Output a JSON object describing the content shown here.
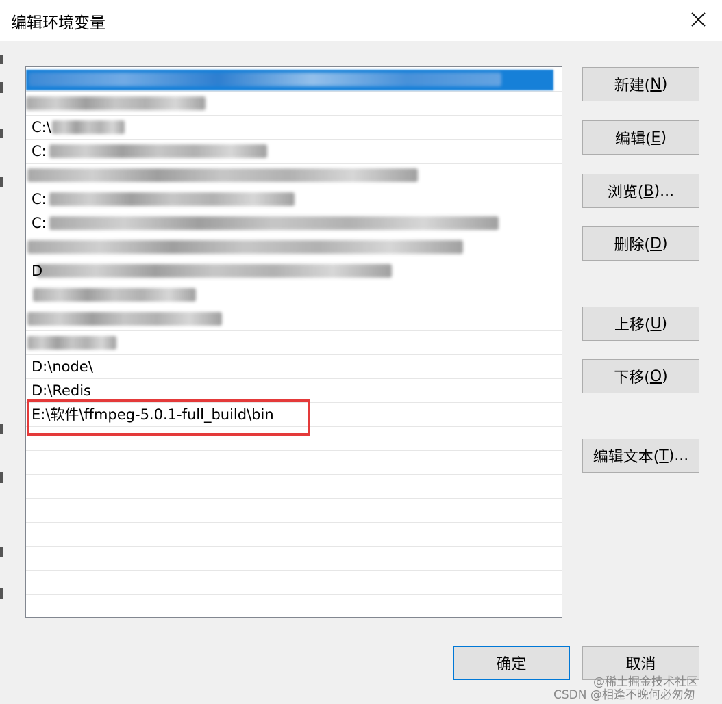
{
  "window": {
    "title": "编辑环境变量",
    "close_icon": "close-icon"
  },
  "list": {
    "items": [
      {
        "prefix": "",
        "selected": true
      },
      {
        "prefix": ""
      },
      {
        "prefix": "C:\\"
      },
      {
        "prefix": "C:"
      },
      {
        "prefix": ""
      },
      {
        "prefix": "C:"
      },
      {
        "prefix": "C:"
      },
      {
        "prefix": ""
      },
      {
        "prefix": "D"
      },
      {
        "prefix": ""
      },
      {
        "prefix": ""
      },
      {
        "prefix": ""
      },
      {
        "prefix": "D:\\node\\"
      },
      {
        "prefix": "D:\\Redis"
      },
      {
        "prefix": "E:\\软件\\ffmpeg-5.0.1-full_build\\bin",
        "highlighted": true
      }
    ]
  },
  "buttons": {
    "new": {
      "label": "新建(",
      "key": "N",
      "suffix": ")"
    },
    "edit": {
      "label": "编辑(",
      "key": "E",
      "suffix": ")"
    },
    "browse": {
      "label": "浏览(",
      "key": "B",
      "suffix": ")..."
    },
    "delete": {
      "label": "删除(",
      "key": "D",
      "suffix": ")"
    },
    "move_up": {
      "label": "上移(",
      "key": "U",
      "suffix": ")"
    },
    "move_down": {
      "label": "下移(",
      "key": "O",
      "suffix": ")"
    },
    "edit_text": {
      "label": "编辑文本(",
      "key": "T",
      "suffix": ")..."
    },
    "ok": {
      "label": "确定"
    },
    "cancel": {
      "label": "取消"
    }
  },
  "watermark": {
    "line1": "@稀土掘金技术社区",
    "line2": "CSDN @相逢不晚何必匆匆"
  },
  "colors": {
    "highlight_border": "#e43a3a",
    "selection": "#0a7ad6",
    "default_button_border": "#0078d7"
  }
}
